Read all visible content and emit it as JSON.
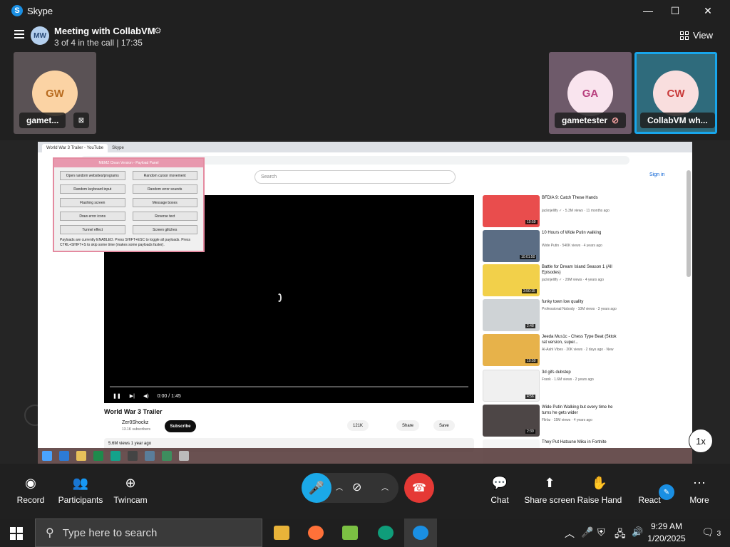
{
  "app": {
    "title": "Skype"
  },
  "window": {
    "minimize": "—",
    "maximize": "☐",
    "close": "✕"
  },
  "meeting": {
    "avatar_initials": "MW",
    "title": "Meeting with CollabVM",
    "subtitle": "3 of 4 in the call | 17:35",
    "view_label": "View"
  },
  "participants": [
    {
      "initials": "GW",
      "name": "gamet...",
      "avatar_bg": "#fbd3a4",
      "initials_color": "#b86b1f",
      "tile_bg": "#5a5255"
    },
    {
      "initials": "GA",
      "name": "gametester",
      "avatar_bg": "#f9e4ee",
      "initials_color": "#b8407e",
      "tile_bg": "#6e5a6a"
    },
    {
      "initials": "CW",
      "name": "CollabVM wh...",
      "avatar_bg": "#f9dede",
      "initials_color": "#c93a3a",
      "tile_bg": "#2f6b7c",
      "active_border": "#18a6ec"
    }
  ],
  "shared_screen": {
    "tabs": [
      "World War 3 Trailer - YouTube",
      "Skype"
    ],
    "search_placeholder": "Search",
    "sign_in": "Sign in",
    "player_time": "0:00 / 1:45",
    "video_title": "World War 3 Trailer",
    "channel": "Zer0Shockz",
    "subscribers": "13.1K subscribers",
    "subscribe": "Subscribe",
    "likes": "121K",
    "share": "Share",
    "save": "Save",
    "views": "5.6M views  1 year ago",
    "recommendations": [
      {
        "title": "BFDIA 9: Catch These Hands",
        "meta": "jacknjellify ✓ · 5.3M views · 11 months ago",
        "duration": "10:59",
        "color": "#e94d4d"
      },
      {
        "title": "10 Hours of Wide Putin walking",
        "meta": "Wide Putin · 540K views · 4 years ago",
        "duration": "10:01:50",
        "color": "#5b6d84"
      },
      {
        "title": "Battle for Dream Island Season 1 (All Episodes)",
        "meta": "jacknjellify ✓ · 29M views · 4 years ago",
        "duration": "3:50:15",
        "color": "#f2d04a"
      },
      {
        "title": "funky town low quality",
        "meta": "Professional Nobody · 10M views · 3 years ago",
        "duration": "2:48",
        "color": "#cfd3d6"
      },
      {
        "title": "Jeeda Mus1c - Chess Type Beat (5ktok rat version, super...",
        "meta": "Al-Aahl Vibes · 20K views · 2 days ago · New",
        "duration": "10:50",
        "color": "#e7b24a"
      },
      {
        "title": "3d gifs dubstep",
        "meta": "Frank · 1.6M views · 2 years ago",
        "duration": "4:56",
        "color": "#f0f0f0"
      },
      {
        "title": "Wide Putin Walking but every time he turns he gets wider",
        "meta": "Flirbz · 15M views · 4 years ago",
        "duration": "2:39",
        "color": "#4d4646"
      },
      {
        "title": "They Put Hatsune Miku in Fortnite",
        "meta": "",
        "duration": "",
        "color": "#f5f5f5"
      }
    ],
    "panel": {
      "title": "MEMZ Clean Version - Payload Panel",
      "buttons": [
        "Open random websites/programs",
        "Random cursor movement",
        "Random keyboard input",
        "Random error sounds",
        "Flashing screen",
        "Message boxes",
        "Draw error icons",
        "Reverse text",
        "Tunnel effect",
        "Screen glitches"
      ],
      "note": "Payloads are currently ENABLED. Press SHIFT+ESC to toggle all payloads. Press CTRL+SHIFT+S to skip some time (makes some payloads faster)."
    },
    "speed": "1x"
  },
  "controls": {
    "record": "Record",
    "participants": "Participants",
    "twincam": "Twincam",
    "chat": "Chat",
    "share_screen": "Share screen",
    "raise_hand": "Raise Hand",
    "react": "React",
    "more": "More"
  },
  "taskbar": {
    "search_placeholder": "Type here to search",
    "time": "9:29 AM",
    "date": "1/20/2025",
    "notifications": "3"
  }
}
